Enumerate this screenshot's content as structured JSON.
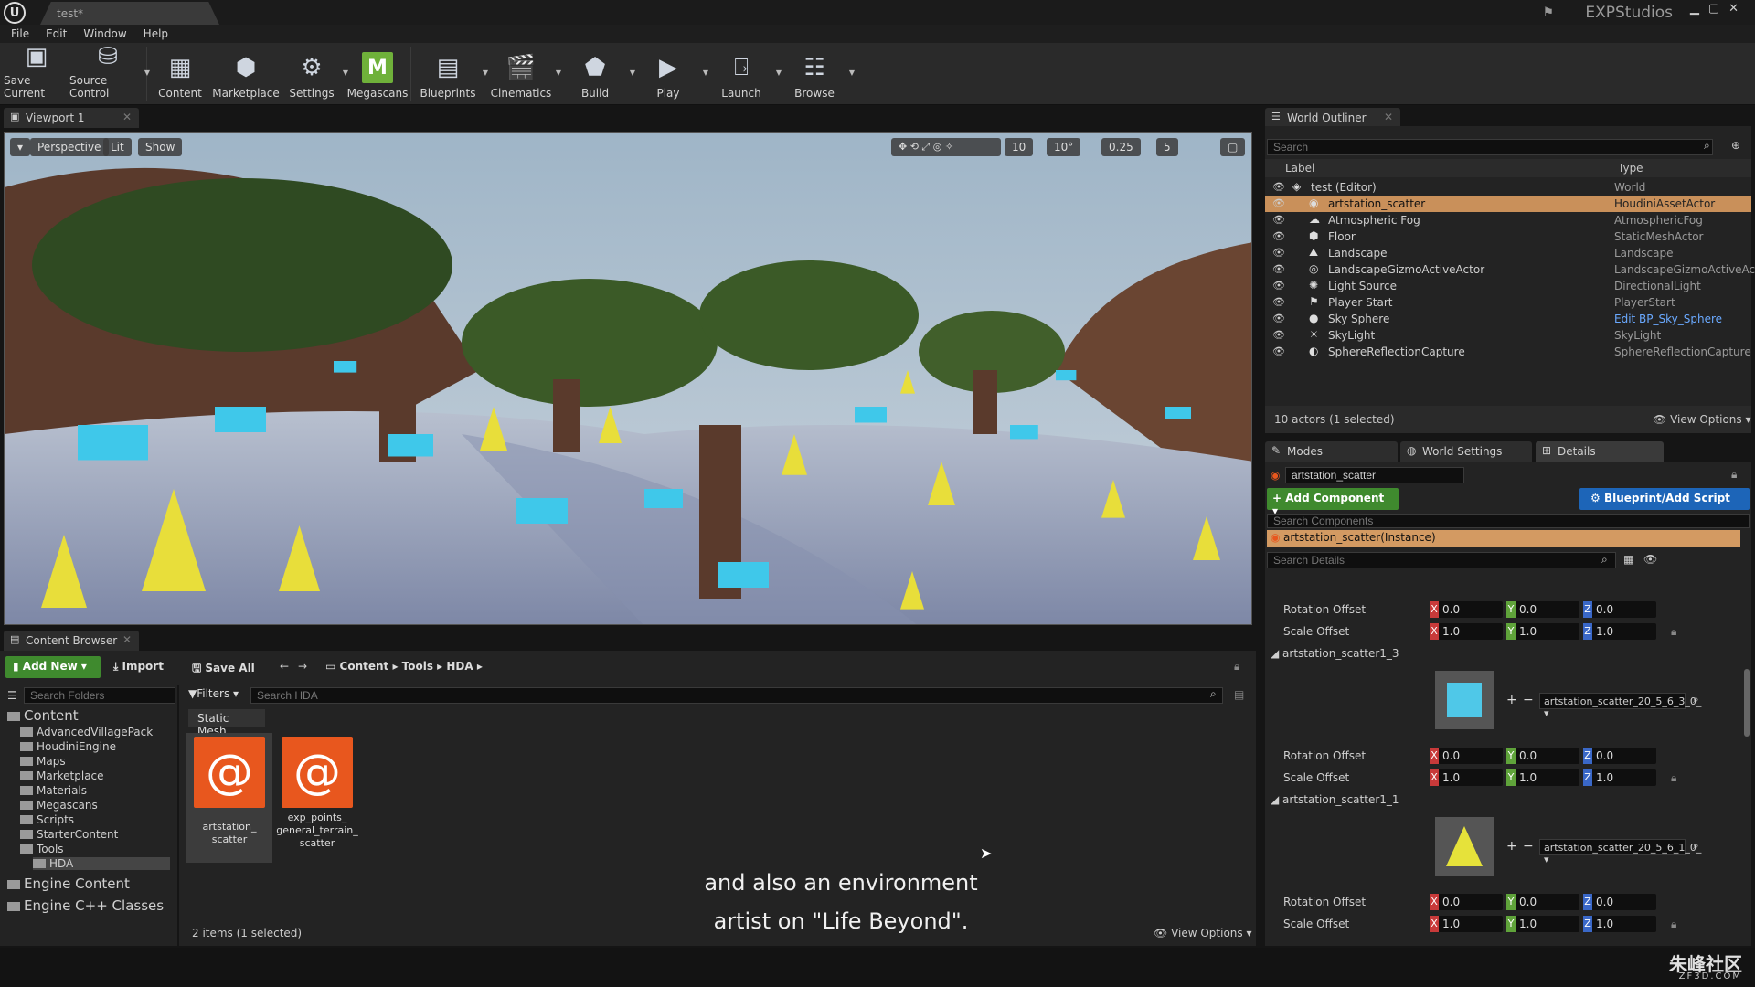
{
  "window": {
    "tab_title": "test*",
    "studio_name": "EXPStudios"
  },
  "menu": [
    "File",
    "Edit",
    "Window",
    "Help"
  ],
  "toolbar": [
    {
      "label": "Save Current",
      "icon": "save-icon"
    },
    {
      "label": "Source Control",
      "icon": "source-control-icon"
    },
    {
      "label": "Content",
      "icon": "content-icon"
    },
    {
      "label": "Marketplace",
      "icon": "marketplace-icon"
    },
    {
      "label": "Settings",
      "icon": "settings-icon"
    },
    {
      "label": "Megascans",
      "icon": "megascans-icon"
    },
    {
      "label": "Blueprints",
      "icon": "blueprints-icon"
    },
    {
      "label": "Cinematics",
      "icon": "cinematics-icon"
    },
    {
      "label": "Build",
      "icon": "build-icon"
    },
    {
      "label": "Play",
      "icon": "play-icon"
    },
    {
      "label": "Launch",
      "icon": "launch-icon"
    },
    {
      "label": "Browse",
      "icon": "browse-icon"
    }
  ],
  "viewport": {
    "tab": "Viewport 1",
    "perspective": "Perspective",
    "lit": "Lit",
    "show": "Show",
    "grid_snap": "10",
    "rot_snap": "10°",
    "scale_snap": "0.25",
    "cam_speed": "5"
  },
  "outliner": {
    "tab": "World Outliner",
    "search_placeholder": "Search",
    "col_label": "Label",
    "col_type": "Type",
    "rows": [
      {
        "label": "test (Editor)",
        "type": "World",
        "icon": "world-icon"
      },
      {
        "label": "artstation_scatter",
        "type": "HoudiniAssetActor",
        "icon": "houdini-icon",
        "selected": true
      },
      {
        "label": "Atmospheric Fog",
        "type": "AtmosphericFog",
        "icon": "fog-icon"
      },
      {
        "label": "Floor",
        "type": "StaticMeshActor",
        "icon": "mesh-icon"
      },
      {
        "label": "Landscape",
        "type": "Landscape",
        "icon": "landscape-icon"
      },
      {
        "label": "LandscapeGizmoActiveActor",
        "type": "LandscapeGizmoActiveAct",
        "icon": "gizmo-icon"
      },
      {
        "label": "Light Source",
        "type": "DirectionalLight",
        "icon": "light-icon"
      },
      {
        "label": "Player Start",
        "type": "PlayerStart",
        "icon": "player-start-icon"
      },
      {
        "label": "Sky Sphere",
        "type": "Edit BP_Sky_Sphere",
        "icon": "sphere-icon",
        "link": true
      },
      {
        "label": "SkyLight",
        "type": "SkyLight",
        "icon": "skylight-icon"
      },
      {
        "label": "SphereReflectionCapture",
        "type": "SphereReflectionCapture",
        "icon": "reflection-icon"
      }
    ],
    "status": "10 actors (1 selected)",
    "view_options": "View Options"
  },
  "details": {
    "tabs": [
      "Modes",
      "World Settings",
      "Details"
    ],
    "actor_name": "artstation_scatter",
    "add_component": "+ Add Component",
    "blueprint_script": "Blueprint/Add Script",
    "search_components_placeholder": "Search Components",
    "instance": "artstation_scatter(Instance)",
    "search_details_placeholder": "Search Details",
    "rotation_label": "Rotation Offset",
    "scale_label": "Scale Offset",
    "top": {
      "rotation": [
        "0.0",
        "0.0",
        "0.0"
      ],
      "scale": [
        "1.0",
        "1.0",
        "1.0"
      ]
    },
    "groups": [
      {
        "name": "artstation_scatter1_3",
        "asset": "artstation_scatter_20_5_6_3_0_",
        "rotation": [
          "0.0",
          "0.0",
          "0.0"
        ],
        "scale": [
          "1.0",
          "1.0",
          "1.0"
        ]
      },
      {
        "name": "artstation_scatter1_1",
        "asset": "artstation_scatter_20_5_6_1_0_",
        "rotation": [
          "0.0",
          "0.0",
          "0.0"
        ],
        "scale": [
          "1.0",
          "1.0",
          "1.0"
        ]
      }
    ]
  },
  "content_browser": {
    "tab": "Content Browser",
    "add_new": "Add New",
    "import": "Import",
    "save_all": "Save All",
    "path": [
      "Content",
      "Tools",
      "HDA"
    ],
    "search_folders_placeholder": "Search Folders",
    "filters": "Filters",
    "search_placeholder": "Search HDA",
    "filter_chip": "Static Mesh",
    "tree": [
      {
        "label": "Content",
        "depth": 0
      },
      {
        "label": "AdvancedVillagePack",
        "depth": 1
      },
      {
        "label": "HoudiniEngine",
        "depth": 1
      },
      {
        "label": "Maps",
        "depth": 1
      },
      {
        "label": "Marketplace",
        "depth": 1
      },
      {
        "label": "Materials",
        "depth": 1
      },
      {
        "label": "Megascans",
        "depth": 1
      },
      {
        "label": "Scripts",
        "depth": 1
      },
      {
        "label": "StarterContent",
        "depth": 1
      },
      {
        "label": "Tools",
        "depth": 1
      },
      {
        "label": "HDA",
        "depth": 2
      },
      {
        "label": "Engine Content",
        "depth": 0
      },
      {
        "label": "Engine C++ Classes",
        "depth": 0
      }
    ],
    "assets": [
      {
        "line1": "artstation_",
        "line2": "scatter",
        "line3": ""
      },
      {
        "line1": "exp_points_",
        "line2": "general_terrain_",
        "line3": "scatter"
      }
    ],
    "status": "2 items (1 selected)",
    "view_options": "View Options"
  },
  "subtitles": [
    "and also an environment",
    "artist on \"Life Beyond\"."
  ],
  "watermark": {
    "cn": "朱峰社区",
    "url": "ZF3D.COM"
  },
  "colors": {
    "accent_green": "#3f8a2e",
    "accent_blue": "#1d65b8",
    "selection": "#c9905a",
    "houdini_orange": "#e8571e"
  }
}
